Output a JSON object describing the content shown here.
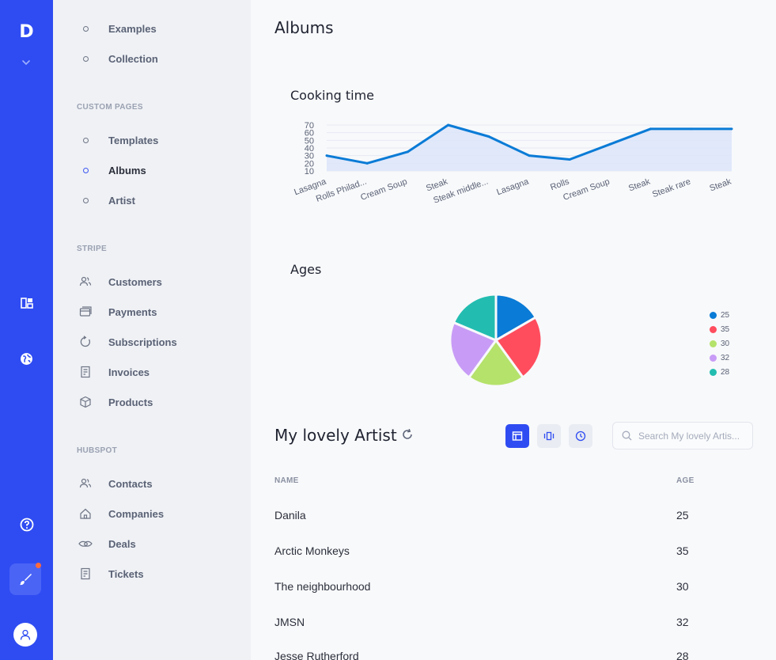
{
  "rail": {
    "logo": "D"
  },
  "nav": {
    "items_top": [
      {
        "label": "Examples",
        "active": false
      },
      {
        "label": "Collection",
        "active": false
      }
    ],
    "custom_pages": {
      "heading": "CUSTOM PAGES",
      "items": [
        {
          "label": "Templates",
          "active": false
        },
        {
          "label": "Albums",
          "active": true
        },
        {
          "label": "Artist",
          "active": false
        }
      ]
    },
    "stripe": {
      "heading": "STRIPE",
      "items": [
        {
          "label": "Customers",
          "icon": "users-icon"
        },
        {
          "label": "Payments",
          "icon": "card-icon"
        },
        {
          "label": "Subscriptions",
          "icon": "refresh-icon"
        },
        {
          "label": "Invoices",
          "icon": "invoice-icon"
        },
        {
          "label": "Products",
          "icon": "box-icon"
        }
      ]
    },
    "hubspot": {
      "heading": "HUBSPOT",
      "items": [
        {
          "label": "Contacts",
          "icon": "users-icon"
        },
        {
          "label": "Companies",
          "icon": "home-icon"
        },
        {
          "label": "Deals",
          "icon": "handshake-icon"
        },
        {
          "label": "Tickets",
          "icon": "ticket-icon"
        }
      ]
    }
  },
  "main": {
    "title": "Albums",
    "line_title": "Cooking time",
    "pie_title": "Ages",
    "table": {
      "title": "My lovely Artist",
      "search_placeholder": "Search My lovely Artis...",
      "headers": [
        "NAME",
        "AGE"
      ],
      "rows": [
        [
          "Danila",
          "25"
        ],
        [
          "Arctic Monkeys",
          "35"
        ],
        [
          "The neighbourhood",
          "30"
        ],
        [
          "JMSN",
          "32"
        ],
        [
          "Jesse Rutherford",
          "28"
        ]
      ]
    }
  },
  "chart_data": [
    {
      "type": "area",
      "title": "Cooking time",
      "categories": [
        "Lasagna",
        "Rolls Philad...",
        "Cream Soup",
        "Steak",
        "Steak middle...",
        "Lasagna",
        "Rolls",
        "Cream Soup",
        "Steak",
        "Steak rare",
        "Steak"
      ],
      "values": [
        30,
        20,
        35,
        70,
        55,
        30,
        25,
        45,
        65,
        65,
        65
      ],
      "y_ticks": [
        10,
        20,
        30,
        40,
        50,
        60,
        70
      ],
      "ylim": [
        10,
        70
      ],
      "color": "#0a7bd6",
      "fill": "#dde6f9"
    },
    {
      "type": "pie",
      "title": "Ages",
      "labels": [
        "25",
        "35",
        "30",
        "32",
        "28"
      ],
      "values": [
        25,
        35,
        30,
        32,
        28
      ],
      "colors": [
        "#0a7bd6",
        "#ff4d5e",
        "#b5e26b",
        "#c89cf6",
        "#22bdb0"
      ],
      "legend": "right"
    }
  ]
}
